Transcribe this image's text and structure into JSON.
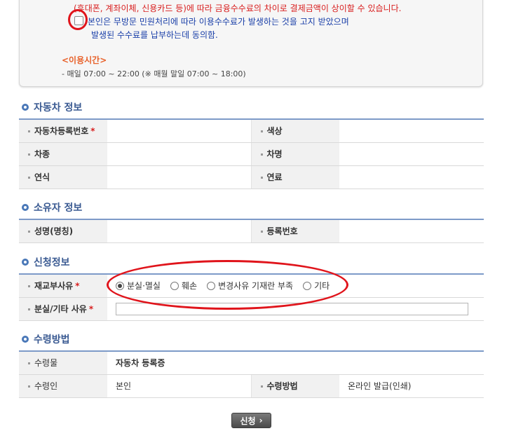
{
  "notice": {
    "fee_line": "(휴대폰, 계좌이체, 신용카드 등)에 따라 금융수수료의 차이로 결제금액이 상이할 수 있습니다.",
    "agree_line1": "본인은 무방문 민원처리에 따라 이용수수료가 발생하는 것을 고지 받았으며",
    "agree_line2": "발생된 수수료를 납부하는데 동의함.",
    "hours_title": "<이용시간>",
    "hours_text": "- 매일 07:00 ~ 22:00 (※ 매월 말일 07:00 ~ 18:00)"
  },
  "vehicle": {
    "title": "자동차 정보",
    "reg_no_label": "자동차등록번호",
    "color_label": "색상",
    "type_label": "차종",
    "name_label": "차명",
    "year_label": "연식",
    "fuel_label": "연료"
  },
  "owner": {
    "title": "소유자 정보",
    "name_label": "성명(명칭)",
    "reg_no_label": "등록번호"
  },
  "application": {
    "title": "신청정보",
    "reason_label": "재교부사유",
    "reasons": [
      "분실·멸실",
      "훼손",
      "변경사유 기재란 부족",
      "기타"
    ],
    "selected_reason": "분실·멸실",
    "other_reason_label": "분실/기타 사유"
  },
  "receipt": {
    "title": "수령방법",
    "item_label": "수령물",
    "item_value": "자동차 등록증",
    "receiver_label": "수령인",
    "receiver_value": "본인",
    "method_label": "수령방법",
    "method_value": "온라인 발급(인쇄)"
  },
  "required_mark": "*",
  "submit_label": "신청",
  "colors": {
    "accent": "#3a5a92",
    "annotation": "#e0141b",
    "warning": "#d81e1e",
    "hours": "#e8612a"
  }
}
